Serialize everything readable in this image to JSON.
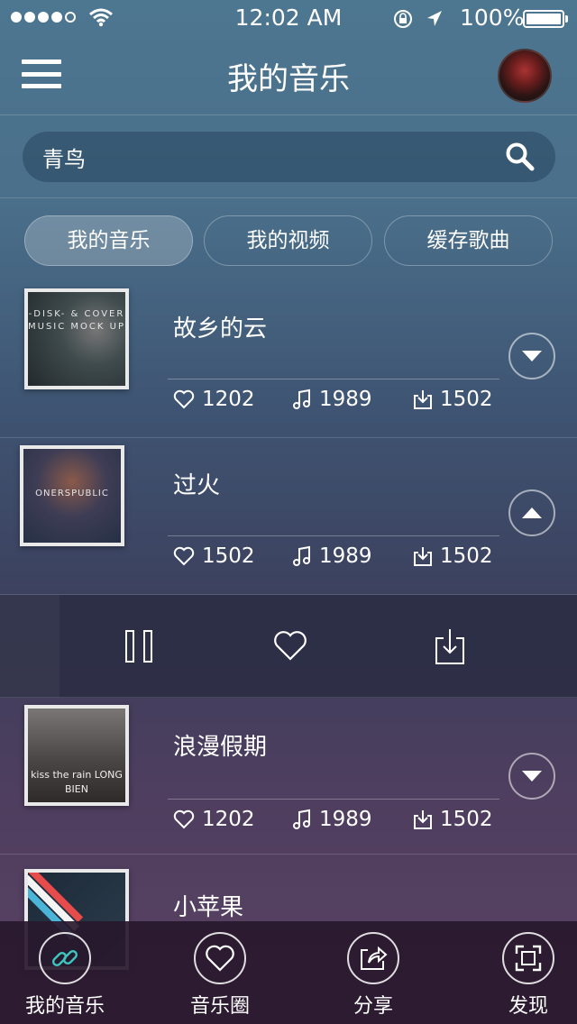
{
  "status_bar": {
    "time": "12:02 AM",
    "battery": "100%"
  },
  "nav": {
    "title": "我的音乐"
  },
  "search": {
    "value": "青鸟"
  },
  "tabs": [
    {
      "label": "我的音乐",
      "active": true
    },
    {
      "label": "我的视频",
      "active": false
    },
    {
      "label": "缓存歌曲",
      "active": false
    }
  ],
  "songs": [
    {
      "title": "故乡的云",
      "likes": "1202",
      "plays": "1989",
      "downloads": "1502",
      "expanded": false
    },
    {
      "title": "过火",
      "likes": "1502",
      "plays": "1989",
      "downloads": "1502",
      "expanded": true
    },
    {
      "title": "浪漫假期",
      "likes": "1202",
      "plays": "1989",
      "downloads": "1502",
      "expanded": false
    },
    {
      "title": "小苹果",
      "likes": "",
      "plays": "",
      "downloads": "",
      "expanded": false
    }
  ],
  "covers": [
    {
      "text": "-DISK- & COVER MUSIC MOCK UP"
    },
    {
      "text": "ONERSPUBLIC"
    },
    {
      "text": "kiss the rain LONG BIEN"
    }
  ],
  "tab_bar": [
    {
      "label": "我的音乐",
      "icon": "link-icon"
    },
    {
      "label": "音乐圈",
      "icon": "heart-icon"
    },
    {
      "label": "分享",
      "icon": "share-icon"
    },
    {
      "label": "发现",
      "icon": "scan-icon"
    }
  ],
  "colors": {
    "background_top": "#4d7690",
    "background_bottom": "#5a4263",
    "accent_teal": "#3ec6c0"
  }
}
